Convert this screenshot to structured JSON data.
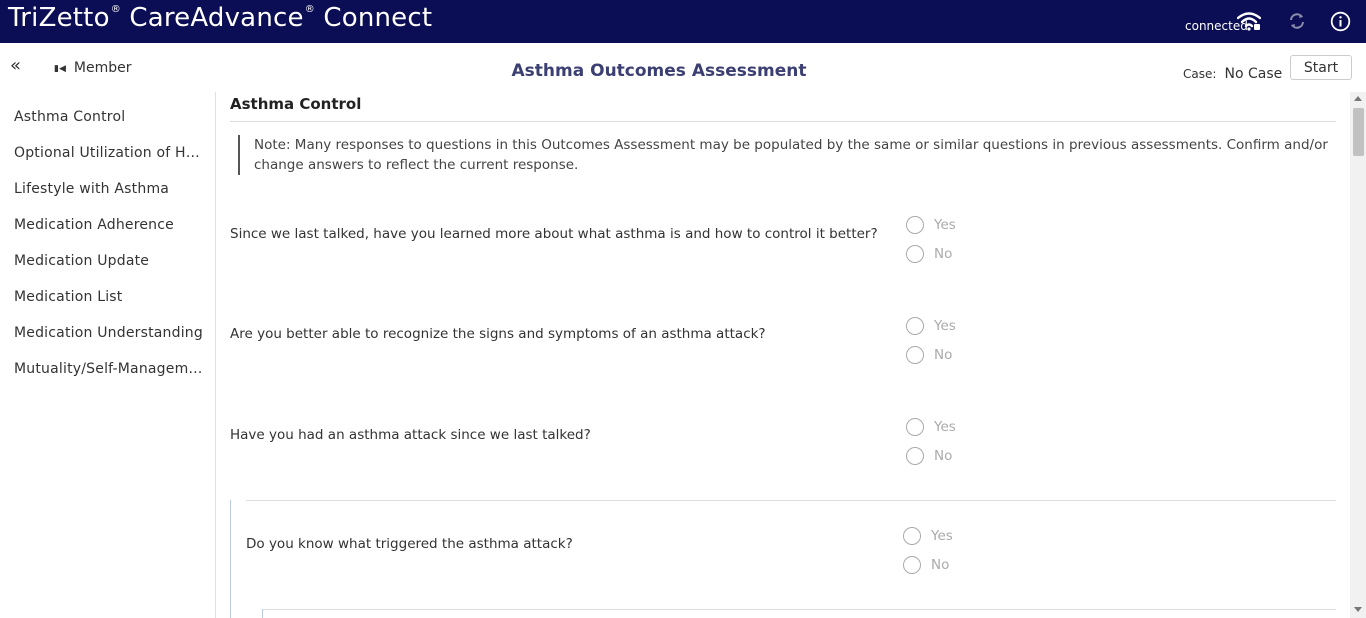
{
  "header": {
    "brand_part1": "TriZetto",
    "brand_mark": "®",
    "brand_part2": "CareAdvance",
    "brand_part3": "Connect",
    "connection_status": "connected",
    "background_color": "#0b0d55"
  },
  "toolbar": {
    "collapse_glyph": "«",
    "member_icon": "skip-back-icon",
    "member_label": "Member",
    "page_title": "Asthma Outcomes Assessment",
    "case_label": "Case:",
    "case_value": "No Case",
    "start_label": "Start"
  },
  "sidebar": {
    "items": [
      {
        "label": "Asthma Control"
      },
      {
        "label": "Optional Utilization of Hospital Services"
      },
      {
        "label": "Lifestyle with Asthma"
      },
      {
        "label": "Medication Adherence"
      },
      {
        "label": "Medication Update"
      },
      {
        "label": "Medication List"
      },
      {
        "label": "Medication Understanding"
      },
      {
        "label": "Mutuality/Self-Management"
      }
    ]
  },
  "main": {
    "section_title": "Asthma Control",
    "note": "Note: Many responses to questions in this Outcomes Assessment may be populated by the same or similar questions in previous assessments. Confirm and/or change answers to reflect the current response.",
    "questions": [
      {
        "text": "Since we last talked, have you learned more about what asthma is and how to control it better?",
        "options": [
          "Yes",
          "No"
        ]
      },
      {
        "text": "Are you better able to recognize the signs and symptoms of an asthma attack?",
        "options": [
          "Yes",
          "No"
        ]
      },
      {
        "text": "Have you had an asthma attack since we last talked?",
        "options": [
          "Yes",
          "No"
        ]
      },
      {
        "text": "Do you know what triggered the asthma attack?",
        "options": [
          "Yes",
          "No"
        ]
      }
    ]
  }
}
